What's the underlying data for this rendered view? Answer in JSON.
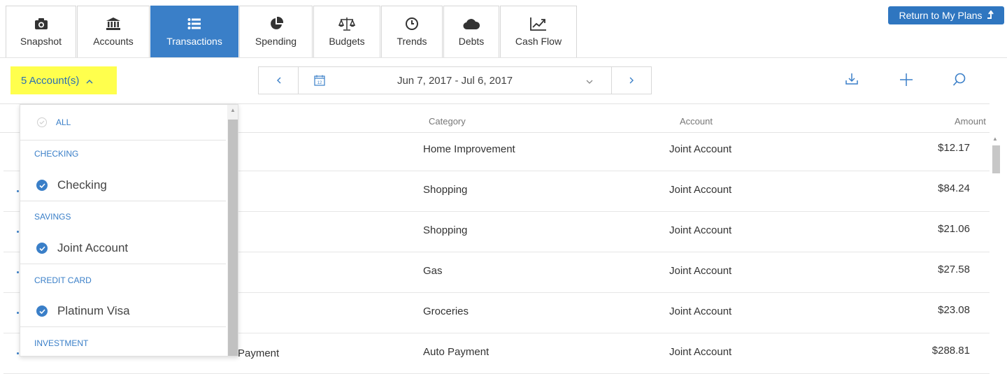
{
  "tabs": [
    {
      "label": "Snapshot",
      "icon": "camera-icon"
    },
    {
      "label": "Accounts",
      "icon": "bank-icon"
    },
    {
      "label": "Transactions",
      "icon": "list-icon",
      "active": true
    },
    {
      "label": "Spending",
      "icon": "pie-chart-icon"
    },
    {
      "label": "Budgets",
      "icon": "scales-icon"
    },
    {
      "label": "Trends",
      "icon": "clock-icon"
    },
    {
      "label": "Debts",
      "icon": "cloud-icon"
    },
    {
      "label": "Cash Flow",
      "icon": "trend-chart-icon"
    }
  ],
  "return_button": {
    "label": "Return to My Plans"
  },
  "account_filter": {
    "label": "5 Account(s)"
  },
  "date_range": {
    "label": "Jun 7, 2017 - Jul 6, 2017",
    "calendar_day": "12"
  },
  "columns": {
    "category": "Category",
    "account": "Account",
    "amount": "Amount"
  },
  "transactions": [
    {
      "description": "",
      "category": "Home Improvement",
      "account": "Joint Account",
      "amount": "$12.17"
    },
    {
      "description": "",
      "category": "Shopping",
      "account": "Joint Account",
      "amount": "$84.24"
    },
    {
      "description": "",
      "category": "Shopping",
      "account": "Joint Account",
      "amount": "$21.06"
    },
    {
      "description": "",
      "category": "Gas",
      "account": "Joint Account",
      "amount": "$27.58"
    },
    {
      "description": "",
      "category": "Groceries",
      "account": "Joint Account",
      "amount": "$23.08"
    },
    {
      "description": "Payment",
      "category": "Auto Payment",
      "account": "Joint Account",
      "amount": "$288.81"
    }
  ],
  "dropdown": {
    "all_label": "ALL",
    "groups": [
      {
        "name": "CHECKING",
        "items": [
          "Checking"
        ]
      },
      {
        "name": "SAVINGS",
        "items": [
          "Joint Account"
        ]
      },
      {
        "name": "CREDIT CARD",
        "items": [
          "Platinum Visa"
        ]
      },
      {
        "name": "INVESTMENT",
        "items": []
      }
    ]
  },
  "colors": {
    "accent": "#3a7fc8",
    "highlight": "#ffff4d",
    "button": "#2f76c0"
  }
}
